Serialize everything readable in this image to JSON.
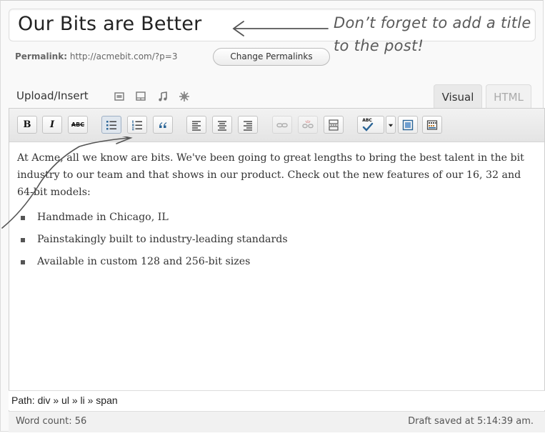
{
  "post": {
    "title": "Our Bits are Better"
  },
  "annotations": {
    "title_note": "Don’t forget to add a title\nto the post!"
  },
  "permalink": {
    "label": "Permalink:",
    "url": "http://acmebit.com/?p=3",
    "button_label": "Change Permalinks"
  },
  "upload": {
    "label": "Upload/Insert",
    "icons": [
      "image-icon",
      "video-icon",
      "audio-icon",
      "media-icon"
    ]
  },
  "tabs": {
    "visual": "Visual",
    "html": "HTML"
  },
  "toolbar": {
    "bold": "B",
    "italic": "I",
    "strike": "ABC",
    "spell": "ABC",
    "icons": [
      "bold-icon",
      "italic-icon",
      "strikethrough-icon",
      "bullet-list-icon",
      "numbered-list-icon",
      "blockquote-icon",
      "align-left-icon",
      "align-center-icon",
      "align-right-icon",
      "link-icon",
      "unlink-icon",
      "more-tag-icon",
      "spellcheck-icon",
      "dropdown-arrow-icon",
      "fullscreen-icon",
      "kitchen-sink-icon"
    ]
  },
  "content": {
    "paragraph": "At Acme, all we know are bits. We've been going to great lengths to bring the best talent in the bit industry to our team and that shows in our product. Check out the new features of our 16, 32 and 64-bit models:",
    "list": [
      "Handmade in Chicago, IL",
      "Painstakingly built to industry-leading standards",
      "Available in custom 128 and 256-bit sizes"
    ]
  },
  "status": {
    "path": "Path: div » ul » li » span",
    "word_count": "Word count: 56",
    "draft_saved": "Draft saved at 5:14:39 am."
  },
  "colors": {
    "accent": "#2a6496",
    "annotation": "#5a5a5a"
  }
}
